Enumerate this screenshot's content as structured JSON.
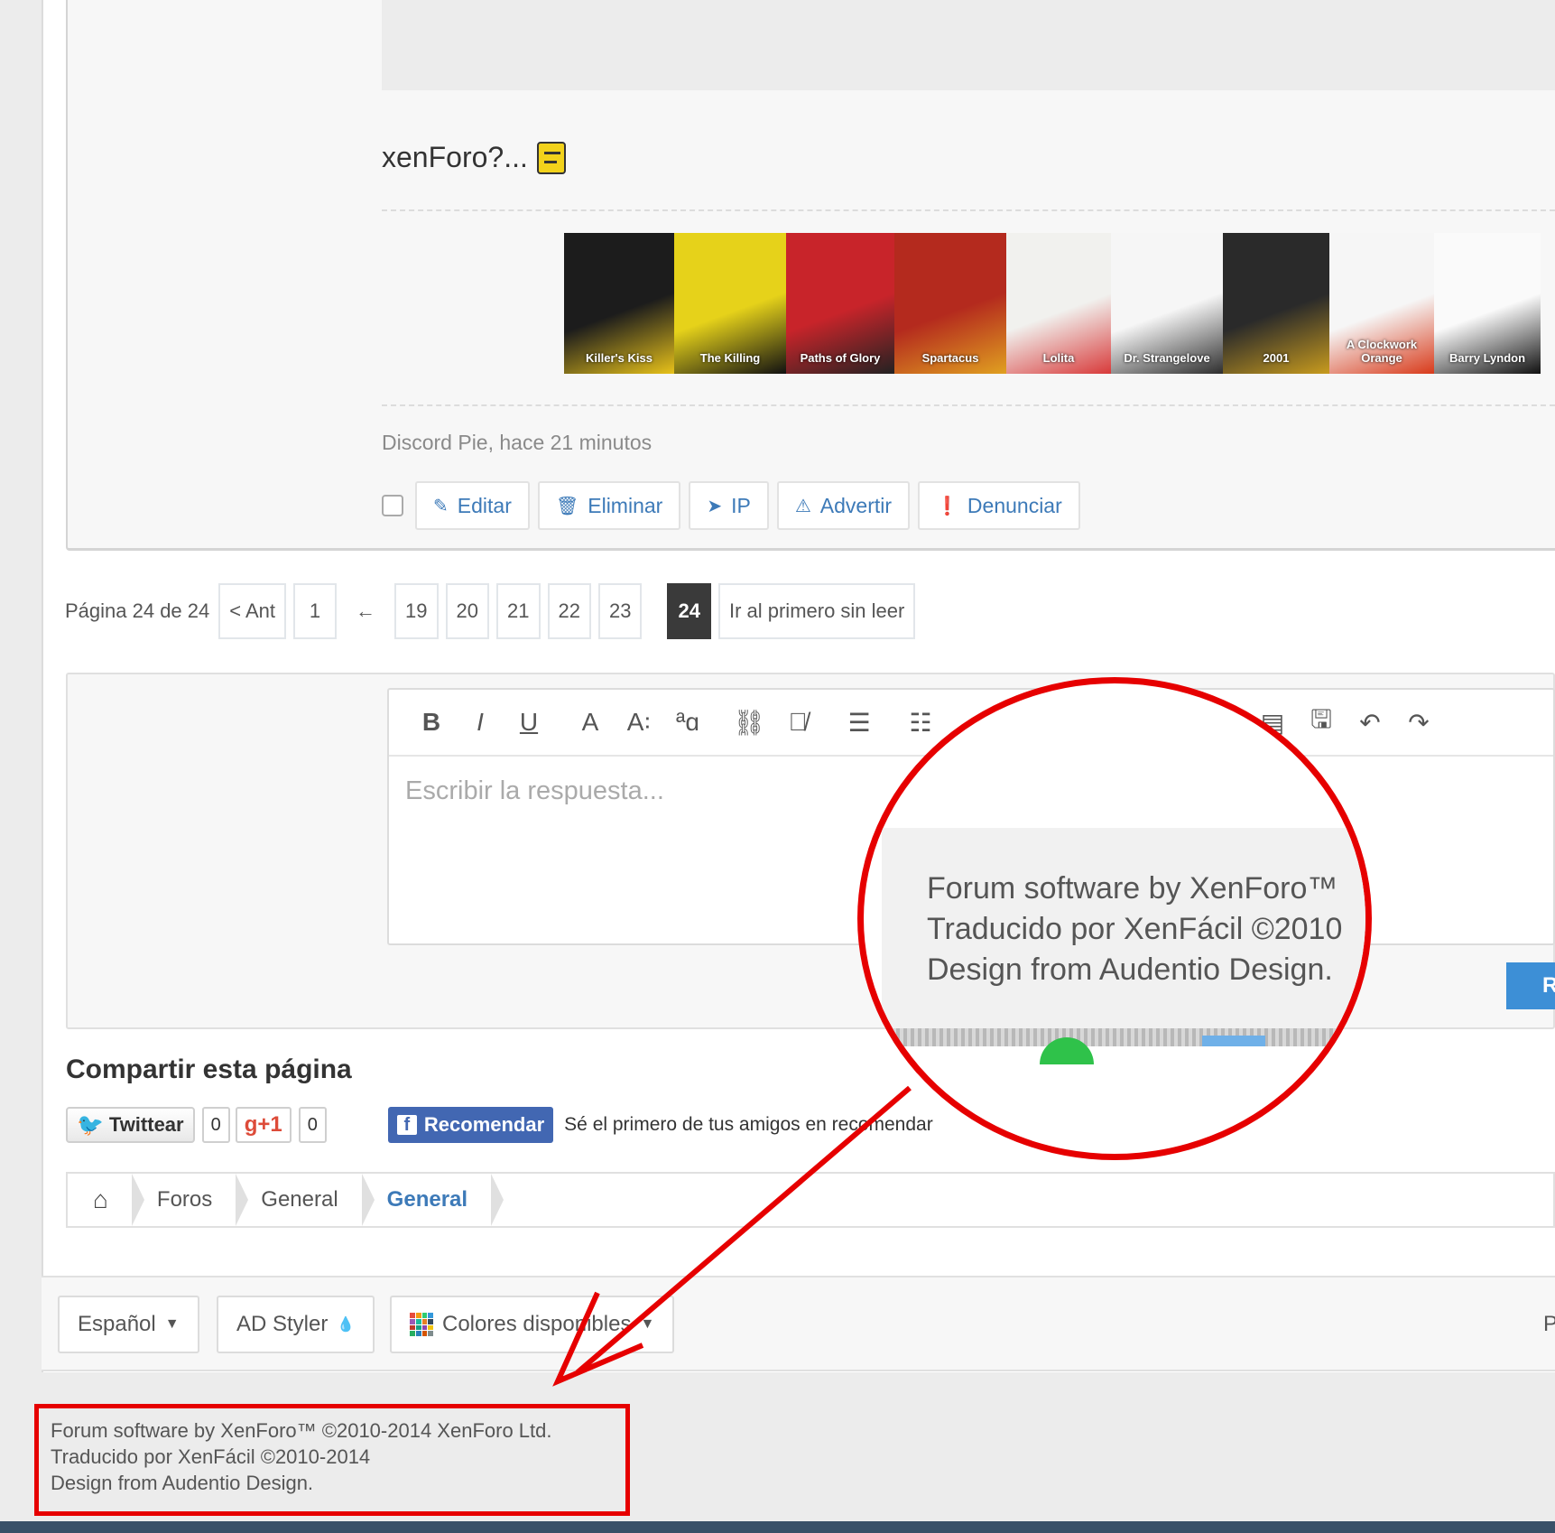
{
  "post": {
    "text": "xenForo?...",
    "author_time": "Discord Pie, hace 21 minutos",
    "posters": [
      {
        "label": "Killer's Kiss",
        "color": "#1c1c1c",
        "accent": "#e8c21a",
        "w": 122
      },
      {
        "label": "The Killing",
        "color": "#e6d21a",
        "accent": "#111111",
        "w": 124
      },
      {
        "label": "Paths of Glory",
        "color": "#c8242a",
        "accent": "#222222",
        "w": 120
      },
      {
        "label": "Spartacus",
        "color": "#b42a1e",
        "accent": "#e0a020",
        "w": 124
      },
      {
        "label": "Lolita",
        "color": "#f1f1ee",
        "accent": "#d83a3a",
        "w": 116
      },
      {
        "label": "Dr. Strangelove",
        "color": "#f6f6f6",
        "accent": "#2e2e2e",
        "w": 124
      },
      {
        "label": "2001",
        "color": "#2a2a2a",
        "accent": "#c89b1e",
        "w": 118
      },
      {
        "label": "A Clockwork Orange",
        "color": "#f6f6f6",
        "accent": "#d83a1a",
        "w": 116
      },
      {
        "label": "Barry Lyndon",
        "color": "#fafafa",
        "accent": "#111111",
        "w": 118
      }
    ],
    "actions": [
      {
        "icon": "✎",
        "label": "Editar",
        "name": "edit-button",
        "icon_name": "pencil-icon"
      },
      {
        "icon": "🗑",
        "label": "Eliminar",
        "name": "delete-button",
        "icon_name": "trash-icon"
      },
      {
        "icon": "➤",
        "label": "IP",
        "name": "ip-button",
        "icon_name": "location-arrow-icon"
      },
      {
        "icon": "⚠",
        "label": "Advertir",
        "name": "warn-button",
        "icon_name": "warning-icon"
      },
      {
        "icon": "❗",
        "label": "Denunciar",
        "name": "report-button",
        "icon_name": "alert-circle-icon"
      }
    ]
  },
  "pager": {
    "label": "Página 24 de 24",
    "prev": "< Ant",
    "first": "1",
    "skip": "←",
    "pages": [
      "19",
      "20",
      "21",
      "22",
      "23"
    ],
    "current": "24",
    "unread": "Ir al primero sin leer"
  },
  "editor": {
    "placeholder": "Escribir la respuesta...",
    "tools": [
      {
        "glyph": "B",
        "name": "bold-icon"
      },
      {
        "glyph": "I",
        "name": "italic-icon"
      },
      {
        "glyph": "U",
        "name": "underline-icon"
      },
      {
        "glyph": "A",
        "name": "font-color-icon"
      },
      {
        "glyph": "A꞉",
        "name": "font-size-icon"
      },
      {
        "glyph": "ªɑ",
        "name": "font-family-icon"
      },
      {
        "glyph": "⛓",
        "name": "link-icon"
      },
      {
        "glyph": "⛓̸",
        "name": "unlink-icon"
      },
      {
        "glyph": "☰",
        "name": "align-icon"
      },
      {
        "glyph": "☷",
        "name": "list-icon"
      }
    ],
    "right_tools": [
      {
        "glyph": "▤",
        "name": "template-icon"
      },
      {
        "glyph": "🖫",
        "name": "save-draft-icon"
      },
      {
        "glyph": "↶",
        "name": "undo-icon"
      },
      {
        "glyph": "↷",
        "name": "redo-icon"
      }
    ],
    "reply_button": "R"
  },
  "share": {
    "title": "Compartir esta página",
    "twitter": "Twittear",
    "twitter_count": "0",
    "gplus": "g+1",
    "gplus_count": "0",
    "facebook": "Recomendar",
    "facebook_text": "Sé el primero de tus amigos en recomendar"
  },
  "breadcrumb": {
    "items": [
      "Foros",
      "General"
    ],
    "current": "General"
  },
  "footer": {
    "language": "Español",
    "styler": "AD Styler",
    "colors": "Colores disponibles",
    "right_cut": "P"
  },
  "copyright": {
    "line1": "Forum software by XenForo™ ©2010-2014 XenForo Ltd.",
    "line2": "Traducido por XenFácil ©2010-2014",
    "line3": "Design from Audentio Design."
  },
  "zoom": {
    "line1": "Forum software by XenForo™",
    "line2": "Traducido por XenFácil ©2010",
    "line3": "Design from Audentio Design."
  },
  "colors": {
    "annotation": "#e60000",
    "link": "#3d7ab8"
  }
}
